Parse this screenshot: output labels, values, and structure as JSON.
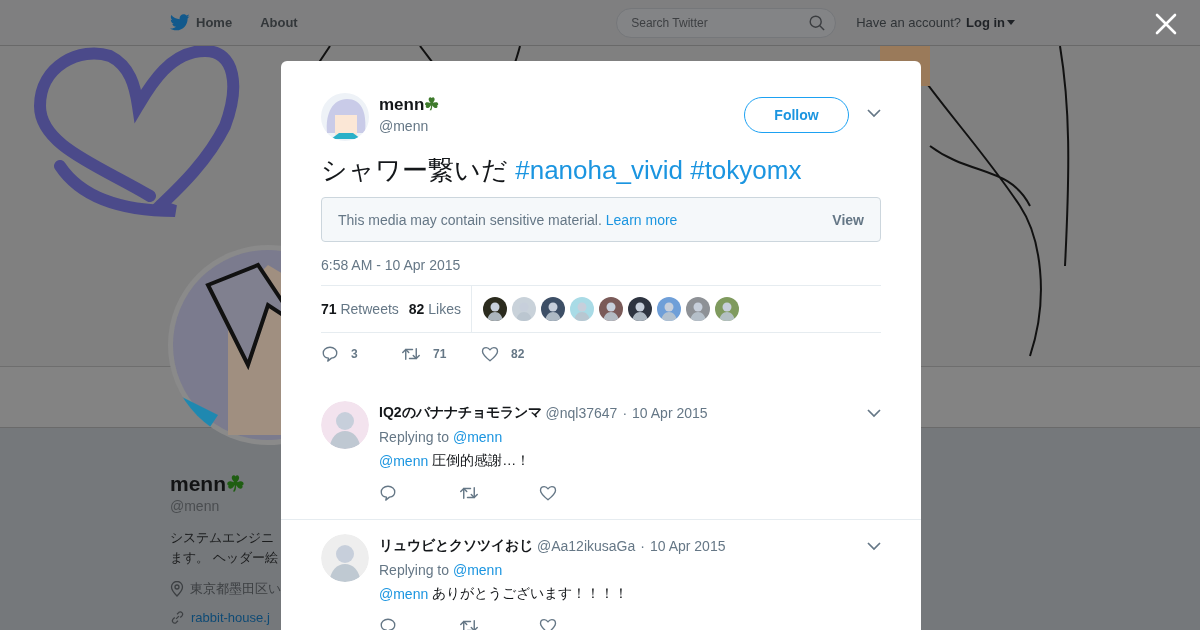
{
  "nav": {
    "items": [
      {
        "label": "Home",
        "kind": "home"
      },
      {
        "label": "About",
        "kind": "plain"
      }
    ],
    "search": {
      "placeholder": "Search Twitter"
    },
    "account_prompt": "Have an account?",
    "login": "Log in"
  },
  "profile": {
    "name": "menn",
    "badge": "☘",
    "handle": "@menn",
    "bio_lines": [
      "システムエンジニ",
      "ます。 ヘッダー絵"
    ],
    "location": "東京都墨田区い",
    "url": "rabbit-house.j"
  },
  "tweet": {
    "author": {
      "name": "menn",
      "badge": "☘",
      "handle": "@menn"
    },
    "follow": "Follow",
    "text": "シャワー繋いだ",
    "hashtags": [
      "#nanoha_vivid",
      "#tokyomx"
    ],
    "sensitive": {
      "message": "This media may contain sensitive material.",
      "link": "Learn more",
      "action": "View"
    },
    "time": "6:58 AM - 10 Apr 2015",
    "stats": [
      {
        "count": "71",
        "label": "Retweets"
      },
      {
        "count": "82",
        "label": "Likes"
      }
    ],
    "likers": [
      {
        "color": "#2b2b1e"
      },
      {
        "color": "#c9d2da"
      },
      {
        "color": "#3d4f66"
      },
      {
        "color": "#a9dbe6"
      },
      {
        "color": "#7a5a58"
      },
      {
        "color": "#2e3440"
      },
      {
        "color": "#6f9fd8"
      },
      {
        "color": "#8e9196"
      },
      {
        "color": "#7f9a5e"
      }
    ],
    "actions": [
      {
        "kind": "reply",
        "count": "3"
      },
      {
        "kind": "retweet",
        "count": "71"
      },
      {
        "kind": "like",
        "count": "82"
      }
    ]
  },
  "replies": [
    {
      "name": "IQ2のバナナチョモランマ",
      "handle": "@nql37647",
      "date": "10 Apr 2015",
      "replying_label": "Replying to",
      "replying_to": "@menn",
      "mention": "@menn",
      "text": "圧倒的感謝…！",
      "separator": "·"
    },
    {
      "name": "リュウビとクソツイおじ",
      "handle": "@Aa12ikusaGa",
      "date": "10 Apr 2015",
      "replying_label": "Replying to",
      "replying_to": "@menn",
      "mention": "@menn",
      "text": "ありがとうございます！！！！",
      "separator": "·"
    }
  ]
}
